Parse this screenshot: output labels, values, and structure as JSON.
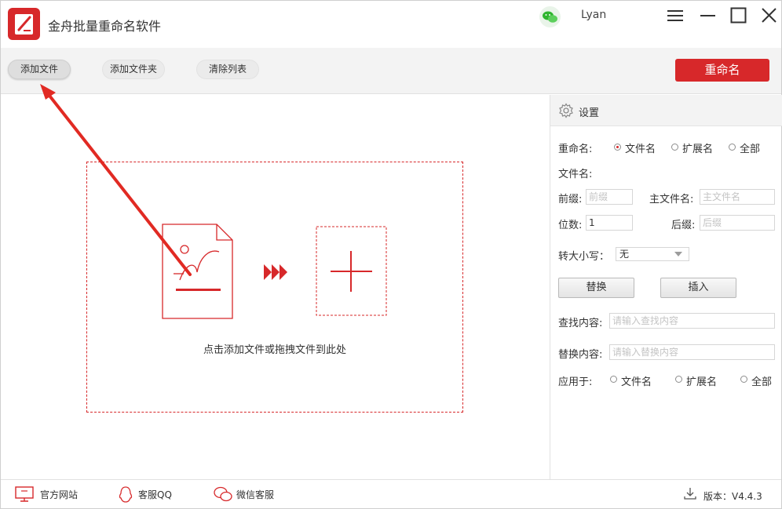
{
  "app": {
    "title": "金舟批量重命名软件",
    "user": "Lyan",
    "brand_color": "#d7282a"
  },
  "window_controls": [
    "menu-icon",
    "minimize-icon",
    "maximize-icon",
    "close-icon"
  ],
  "toolbar": {
    "add_file": "添加文件",
    "add_folder": "添加文件夹",
    "clear_list": "清除列表",
    "rename": "重命名"
  },
  "drop_zone": {
    "hint": "点击添加文件或拖拽文件到此处"
  },
  "settings": {
    "title": "设置",
    "rename_label": "重命名:",
    "rename_options": [
      "文件名",
      "扩展名",
      "全部"
    ],
    "rename_selected": "文件名",
    "filename_label": "文件名:",
    "prefix_label": "前缀:",
    "prefix_placeholder": "前缀",
    "main_name_label": "主文件名:",
    "main_name_placeholder": "主文件名",
    "digits_label": "位数:",
    "digits_value": "1",
    "suffix_label": "后缀:",
    "suffix_placeholder": "后缀",
    "case_label": "转大小写：",
    "case_value": "无",
    "replace_button": "替换",
    "insert_button": "插入",
    "find_label": "查找内容:",
    "find_placeholder": "请输入查找内容",
    "replace_label": "替换内容:",
    "replace_placeholder": "请输入替换内容",
    "apply_label": "应用于:",
    "apply_options": [
      "文件名",
      "扩展名",
      "全部"
    ]
  },
  "footer": {
    "website": "官方网站",
    "qq": "客服QQ",
    "wechat": "微信客服",
    "version": "版本：V4.4.3"
  }
}
